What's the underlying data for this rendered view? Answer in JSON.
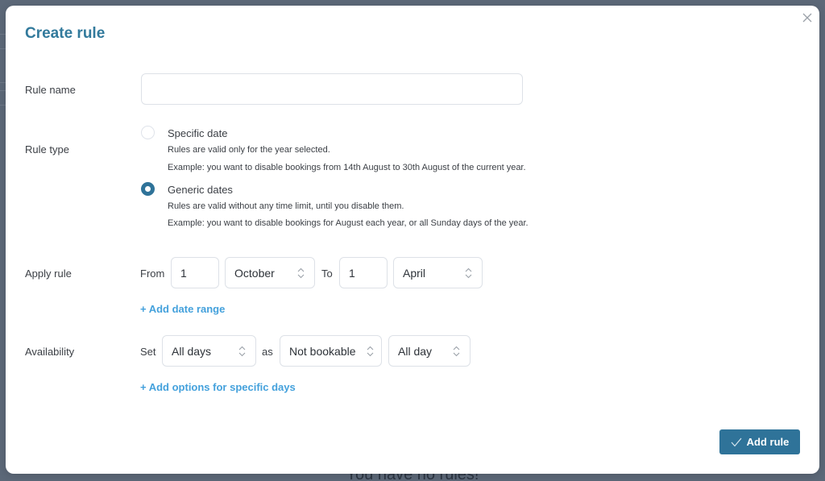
{
  "background": {
    "behind_text": "You have no rules!"
  },
  "modal": {
    "title": "Create rule",
    "close_icon": "close-icon",
    "rule_name": {
      "label": "Rule name",
      "value": "",
      "placeholder": ""
    },
    "rule_type": {
      "label": "Rule type",
      "options": [
        {
          "title": "Specific date",
          "checked": false,
          "desc1": "Rules are valid only for the year selected.",
          "desc2": "Example: you want to disable bookings from 14th August to 30th August of the current year."
        },
        {
          "title": "Generic dates",
          "checked": true,
          "desc1": "Rules are valid without any time limit, until you disable them.",
          "desc2": "Example: you want to disable bookings for August each year, or all Sunday days of the year."
        }
      ]
    },
    "apply_rule": {
      "label": "Apply rule",
      "from_label": "From",
      "from_day": "1",
      "from_month": "October",
      "to_label": "To",
      "to_day": "1",
      "to_month": "April",
      "add_link": "+ Add date range"
    },
    "availability": {
      "label": "Availability",
      "set_label": "Set",
      "days": "All days",
      "as_label": "as",
      "status": "Not bookable",
      "time": "All day",
      "add_link": "+ Add options for specific days"
    },
    "submit": {
      "label": "Add rule",
      "icon": "check-icon"
    }
  },
  "colors": {
    "accent": "#2f7399",
    "title": "#327a9c",
    "link": "#44a1dc",
    "backdrop": "#5c6878"
  }
}
